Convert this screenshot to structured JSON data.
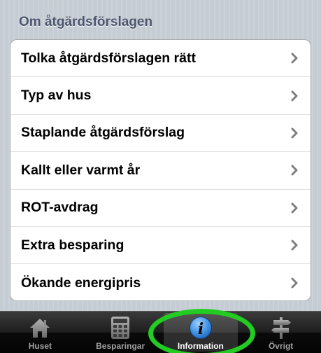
{
  "section": {
    "header": "Om åtgärdsförslagen"
  },
  "list": {
    "items": [
      {
        "label": "Tolka åtgärdsförslagen rätt"
      },
      {
        "label": "Typ av hus"
      },
      {
        "label": "Staplande åtgärdsförslag"
      },
      {
        "label": "Kallt eller varmt år"
      },
      {
        "label": "ROT-avdrag"
      },
      {
        "label": "Extra besparing"
      },
      {
        "label": "Ökande energipris"
      }
    ]
  },
  "tabbar": {
    "tabs": [
      {
        "label": "Huset",
        "icon": "house-icon"
      },
      {
        "label": "Besparingar",
        "icon": "calculator-icon"
      },
      {
        "label": "Information",
        "icon": "info-icon",
        "active": true
      },
      {
        "label": "Övrigt",
        "icon": "signpost-icon"
      }
    ]
  },
  "colors": {
    "highlight": "#22cc22",
    "section_header": "#4c566c",
    "active_icon": "#3d8fe0"
  }
}
